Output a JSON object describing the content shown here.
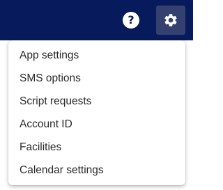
{
  "header": {
    "background": "#061a5c",
    "help_glyph": "?",
    "help_icon": "question-circle-icon",
    "settings_icon": "gear-icon"
  },
  "menu": {
    "items": [
      {
        "label": "App settings"
      },
      {
        "label": "SMS options"
      },
      {
        "label": "Script requests"
      },
      {
        "label": "Account ID"
      },
      {
        "label": "Facilities"
      },
      {
        "label": "Calendar settings"
      }
    ]
  }
}
